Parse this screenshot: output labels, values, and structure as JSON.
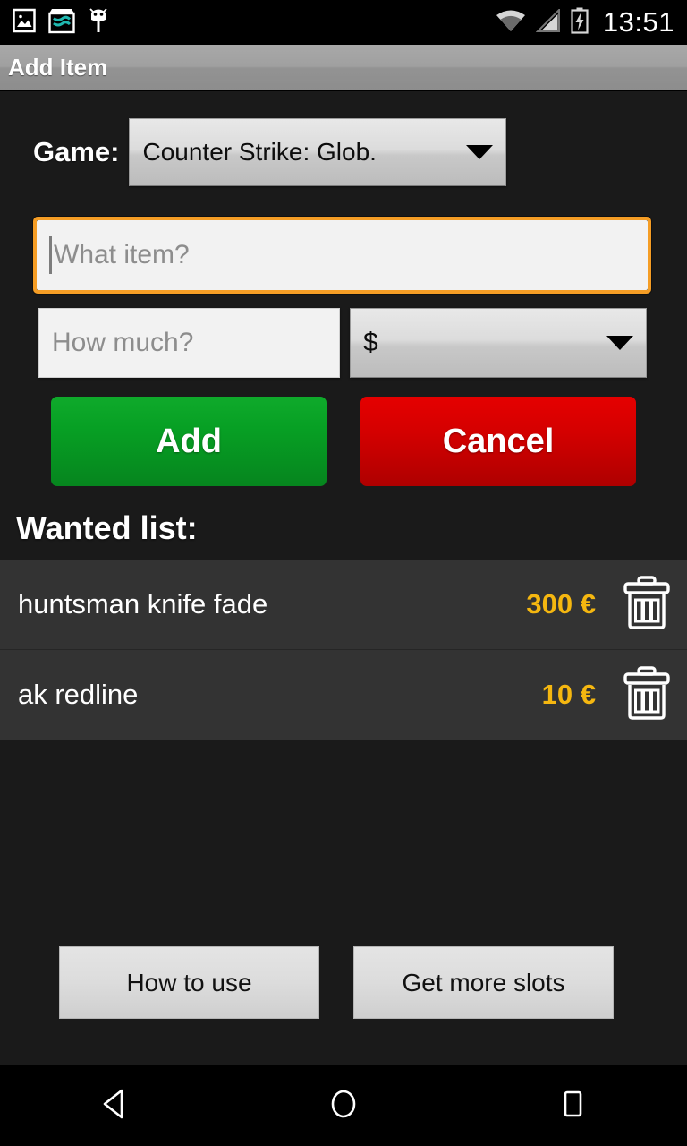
{
  "status_bar": {
    "icons": [
      "photo-icon",
      "shop-icon",
      "android-bug-icon"
    ],
    "wifi_icon": "wifi-icon",
    "signal_icon": "cell-signal-icon",
    "battery_icon": "battery-charging-icon",
    "time": "13:51"
  },
  "action_bar": {
    "title": "Add Item"
  },
  "form": {
    "game_label": "Game:",
    "game_value": "Counter Strike: Glob.",
    "item_placeholder": "What item?",
    "item_value": "",
    "price_placeholder": "How much?",
    "price_value": "",
    "currency_value": "$",
    "add_label": "Add",
    "cancel_label": "Cancel"
  },
  "wanted": {
    "title": "Wanted list:",
    "items": [
      {
        "name": "huntsman knife fade",
        "price": "300 €",
        "delete_icon": "trash-icon"
      },
      {
        "name": "ak redline",
        "price": "10 €",
        "delete_icon": "trash-icon"
      }
    ]
  },
  "bottom": {
    "how_to_use": "How to use",
    "get_more_slots": "Get more slots"
  },
  "nav_bar": {
    "back": "back-icon",
    "home": "home-icon",
    "recents": "recents-icon"
  },
  "colors": {
    "accent_orange": "#f59d25",
    "price_gold": "#f5b710",
    "add_green": "#07a024",
    "cancel_red": "#d40000",
    "background": "#1a1a1a",
    "row_background": "#333333"
  }
}
